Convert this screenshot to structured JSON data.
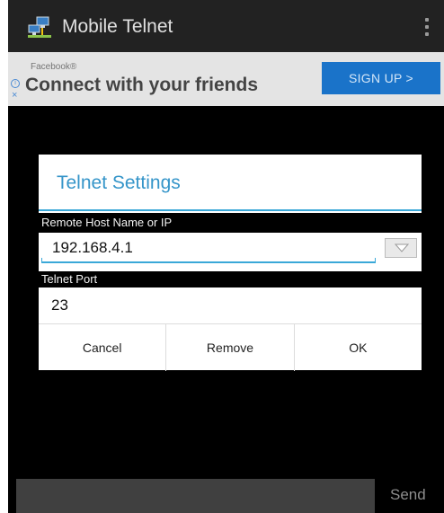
{
  "app": {
    "title": "Mobile Telnet",
    "icon": "network-computers-icon",
    "overflow_icon": "overflow-menu-icon"
  },
  "ad": {
    "sponsor": "Facebook®",
    "headline": "Connect with your friends",
    "cta": "SIGN UP >",
    "info_icon": "i",
    "close_icon": "×",
    "cta_color": "#1a73c9"
  },
  "dialog": {
    "title": "Telnet Settings",
    "accent_color": "#3aa8d8",
    "host_label": "Remote Host Name or IP",
    "host_value": "192.168.4.1",
    "dropdown_icon": "chevron-down-icon",
    "port_label": "Telnet Port",
    "port_value": "23",
    "buttons": {
      "cancel": "Cancel",
      "remove": "Remove",
      "ok": "OK"
    }
  },
  "command_bar": {
    "send_label": "Send"
  }
}
